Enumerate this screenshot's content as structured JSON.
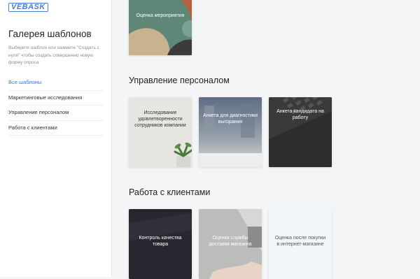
{
  "logo": {
    "text": "VEBASK"
  },
  "sidebar": {
    "title": "Галерея шаблонов",
    "hint": "Выберите шаблон или нажмите \"Создать с нуля\" чтобы создать совершенно новую форму опроса",
    "items": [
      {
        "label": "Все шаблоны"
      },
      {
        "label": "Маркетинговые исследования"
      },
      {
        "label": "Управление персоналом"
      },
      {
        "label": "Работа с клиентами"
      }
    ]
  },
  "sections": [
    {
      "title": "",
      "cards": [
        {
          "label": "Оценка мероприятия"
        }
      ]
    },
    {
      "title": "Управление персоналом",
      "cards": [
        {
          "label": "Исследование удовлетворенности сотрудников компании"
        },
        {
          "label": "Анкета для диагностики выгорания"
        },
        {
          "label": "Анкета кандидата на работу"
        }
      ]
    },
    {
      "title": "Работа с клиентами",
      "cards": [
        {
          "label": "Контроль качества товара"
        },
        {
          "label": "Оценка службы доставки магазина"
        },
        {
          "label": "Оценка после покупки в интернет-магазине"
        }
      ]
    }
  ],
  "colors": {
    "accent": "#2f7be5",
    "sidebar_bg": "#ffffff",
    "main_bg": "#f4f5f7"
  }
}
